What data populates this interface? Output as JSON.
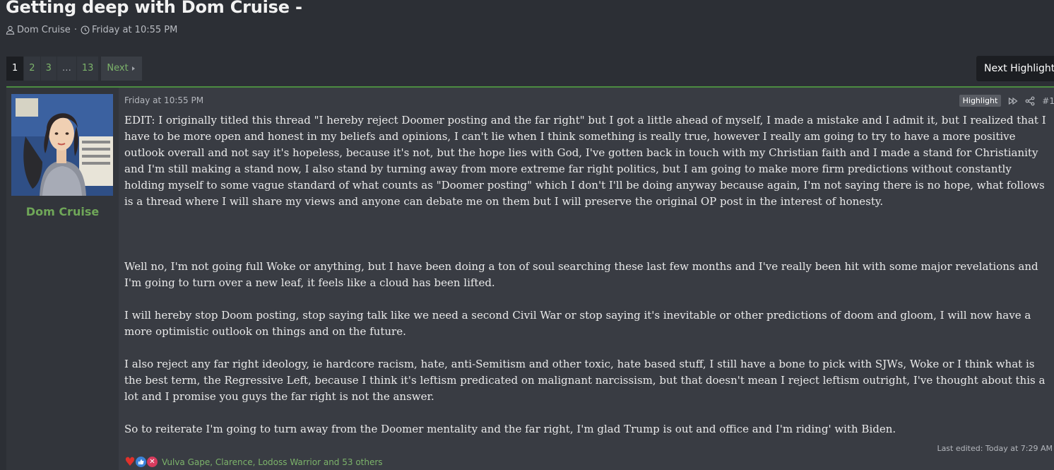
{
  "thread": {
    "title": "Getting deep with Dom Cruise -",
    "author": "Dom Cruise",
    "separator": "·",
    "date": "Friday at 10:55 PM"
  },
  "pagination": {
    "pages": [
      "1",
      "2",
      "3",
      "…",
      "13"
    ],
    "current": "1",
    "next_label": "Next"
  },
  "next_highlight_label": "Next Highlight",
  "post": {
    "username": "Dom Cruise",
    "date": "Friday at 10:55 PM",
    "highlight_label": "Highlight",
    "post_number": "#1",
    "paragraphs": [
      "EDIT: I originally titled this thread \"I hereby reject Doomer posting and the far right\" but I got a little ahead of myself, I made a mistake and I admit it, but I realized that I have to be more open and honest in my beliefs and opinions, I can't lie when I think something is really true, however I really am going to try to have a more positive outlook overall and not say it's hopeless, because it's not, but the hope lies with God, I've gotten back in touch with my Christian faith and I made a stand for Christianity and I'm still making a stand now, I also stand by turning away from more extreme far right politics, but I am going to make more firm predictions without constantly holding myself to some vague standard of what counts as \"Doomer posting\" which I don't I'll be doing anyway because again, I'm not saying there is no hope, what follows is a thread where I will share my views and anyone can debate me on them but I will preserve the original OP post in the interest of honesty.",
      "Well no, I'm not going full Woke or anything, but I have been doing a ton of soul searching these last few months and I've really been hit with some major revelations and I'm going to turn over a new leaf, it feels like a cloud has been lifted.",
      "I will hereby stop Doom posting, stop saying talk like we need a second Civil War or stop saying it's inevitable or other predictions of doom and gloom, I will now have a more optimistic outlook on things and on the future.",
      "I also reject any far right ideology, ie hardcore racism, hate, anti-Semitism and other toxic, hate based stuff, I still have a bone to pick with SJWs, Woke or I think what is the best term, the Regressive Left, because I think it's leftism predicated on malignant narcissism, but that doesn't mean I reject leftism outright, I've thought about this a lot and I promise you guys the far right is not the answer.",
      "So to reiterate I'm going to turn away from the Doomer mentality and the far right, I'm glad Trump is out and office and I'm riding' with Biden."
    ],
    "last_edited": "Last edited: Today at 7:29 AM",
    "reactions": {
      "icons": [
        "heart-icon",
        "like-icon",
        "dislike-icon"
      ],
      "names": "Vulva Gape, Clarence, Lodoss Warrior and 53 others"
    }
  },
  "colors": {
    "accent_green": "#7cb36a",
    "username_green": "#6fa658",
    "post_border": "#4c8c41",
    "background": "#2c2f35"
  }
}
